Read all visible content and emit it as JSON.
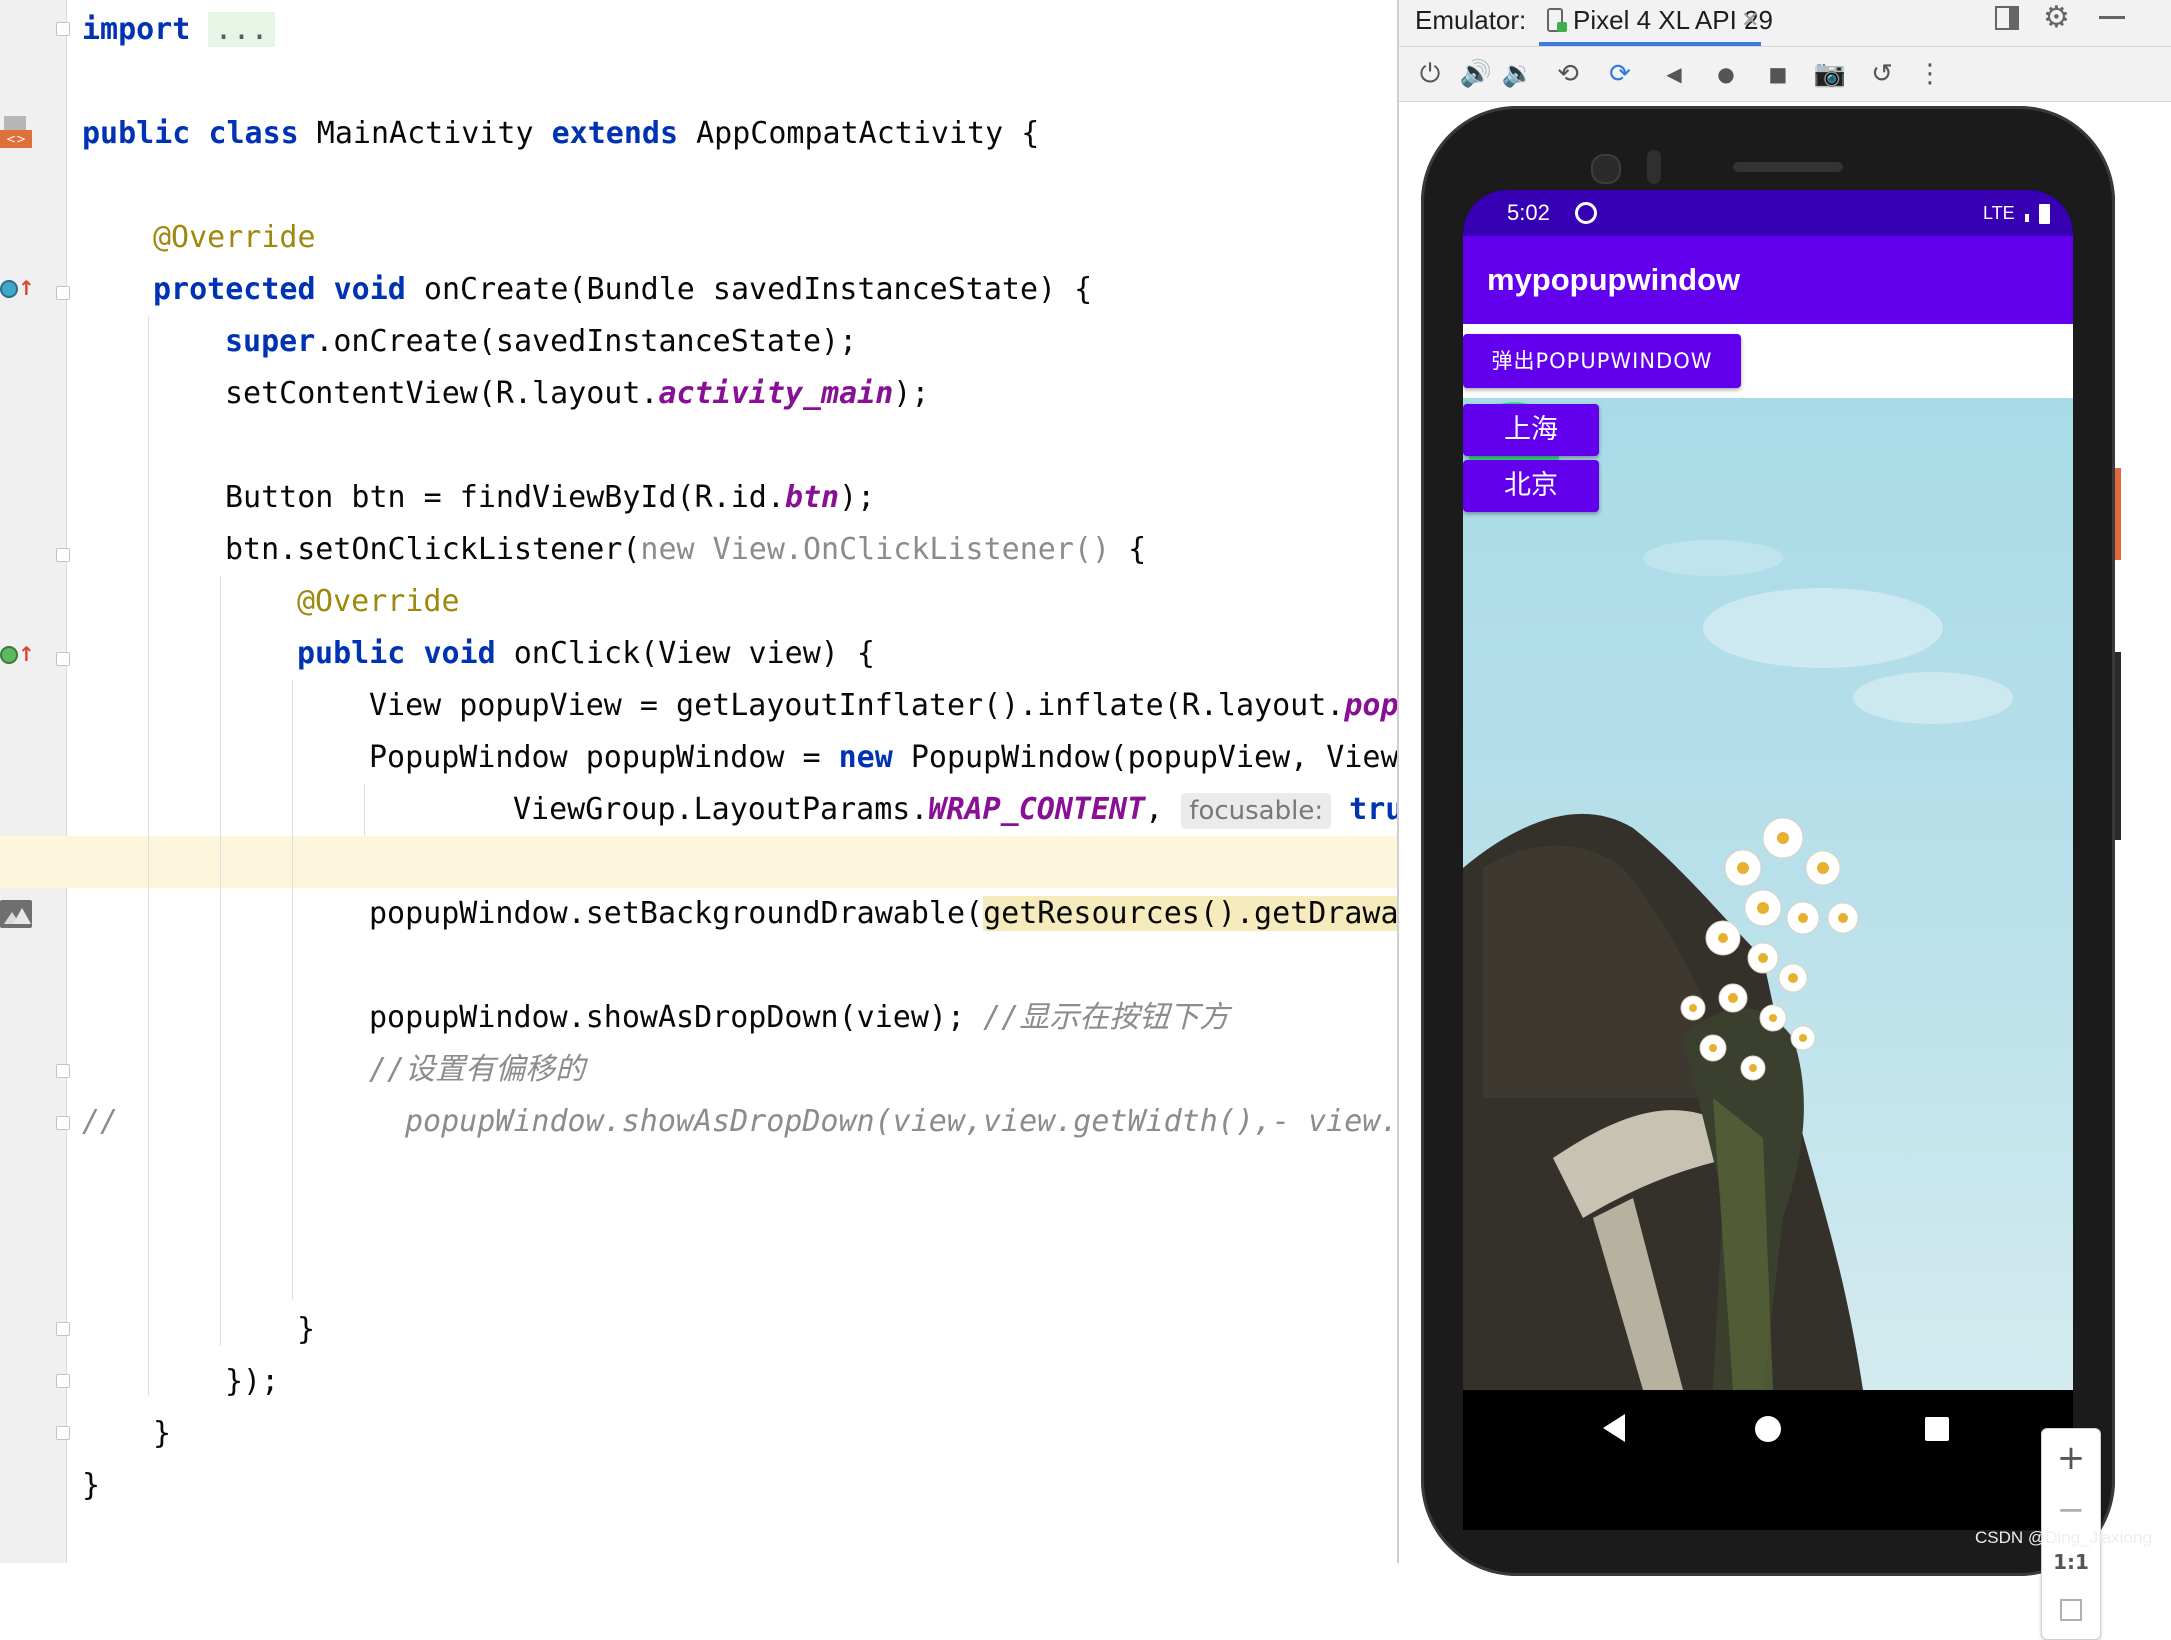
{
  "editor": {
    "lines": {
      "import_kw": "import",
      "import_folded": "...",
      "class_public": "public",
      "class_class": "class",
      "class_name": " MainActivity ",
      "class_extends": "extends",
      "class_parent": " AppCompatActivity {",
      "override1": "@Override",
      "oncreate_protected": "protected",
      "oncreate_void": "void",
      "oncreate_sig": " onCreate(Bundle savedInstanceState) {",
      "super_kw": "super",
      "super_rest": ".onCreate(savedInstanceState);",
      "setcontent_pre": "setContentView(R.layout.",
      "setcontent_field": "activity_main",
      "setcontent_post": ");",
      "button_pre": "Button btn = findViewById(R.id.",
      "button_field": "btn",
      "button_post": ");",
      "listener_pre": "btn.setOnClickListener(",
      "listener_new": "new",
      "listener_type": " View.OnClickListener()",
      "listener_post": " {",
      "override2": "@Override",
      "onclick_public": "public",
      "onclick_void": "void",
      "onclick_sig": " onClick(View view) {",
      "popupview_pre": "View popupView = getLayoutInflater().inflate(R.layout.",
      "popupview_field": "pop",
      "popupwindow_pre": "PopupWindow popupWindow = ",
      "popupwindow_new": "new",
      "popupwindow_post": " PopupWindow(popupView, View",
      "layoutparams_pre": "ViewGroup.LayoutParams.",
      "layoutparams_field": "WRAP_CONTENT",
      "layoutparams_comma": ", ",
      "layoutparams_hint": "focusable:",
      "layoutparams_true": "true",
      "setbg_pre": "popupWindow.setBackgroundDrawable(",
      "setbg_mark": "getResources().getDrawa",
      "showdrop_code": "popupWindow.showAsDropDown(view); ",
      "showdrop_comment": "//显示在按钮下方",
      "offset_comment": "//设置有偏移的",
      "commented_prefix": "//",
      "commented_code": "popupWindow.showAsDropDown(view,view.getWidth(),- view.",
      "close_onclick": "}",
      "close_listener": "});",
      "close_oncreate": "}",
      "close_class": "}"
    }
  },
  "emulator": {
    "label": "Emulator:",
    "device_tab": "Pixel 4 XL API 29",
    "toolbar_icons": [
      "power-icon",
      "volume-up-icon",
      "volume-down-icon",
      "rotate-left-icon",
      "rotate-right-icon",
      "back-icon",
      "home-icon",
      "overview-icon",
      "screenshot-icon",
      "snapshot-icon",
      "more-icon"
    ],
    "phone": {
      "status_time": "5:02",
      "status_network": "LTE",
      "app_title": "mypopupwindow",
      "main_button": "弹出POPUPWINDOW",
      "popup_items": [
        "上海",
        "北京"
      ]
    },
    "zoom": {
      "zoom_in": "+",
      "zoom_out": "−",
      "actual_size": "1:1"
    }
  },
  "watermark": "CSDN @Ding_Jiaxiong",
  "colors": {
    "keyword": "#0033b3",
    "annotation": "#9e880d",
    "field": "#871094",
    "comment": "#8c8c8c",
    "app_primary": "#6200ee",
    "app_primary_dark": "#3700b3",
    "current_line": "#fdf6dc",
    "tab_underline": "#3d7be0"
  }
}
